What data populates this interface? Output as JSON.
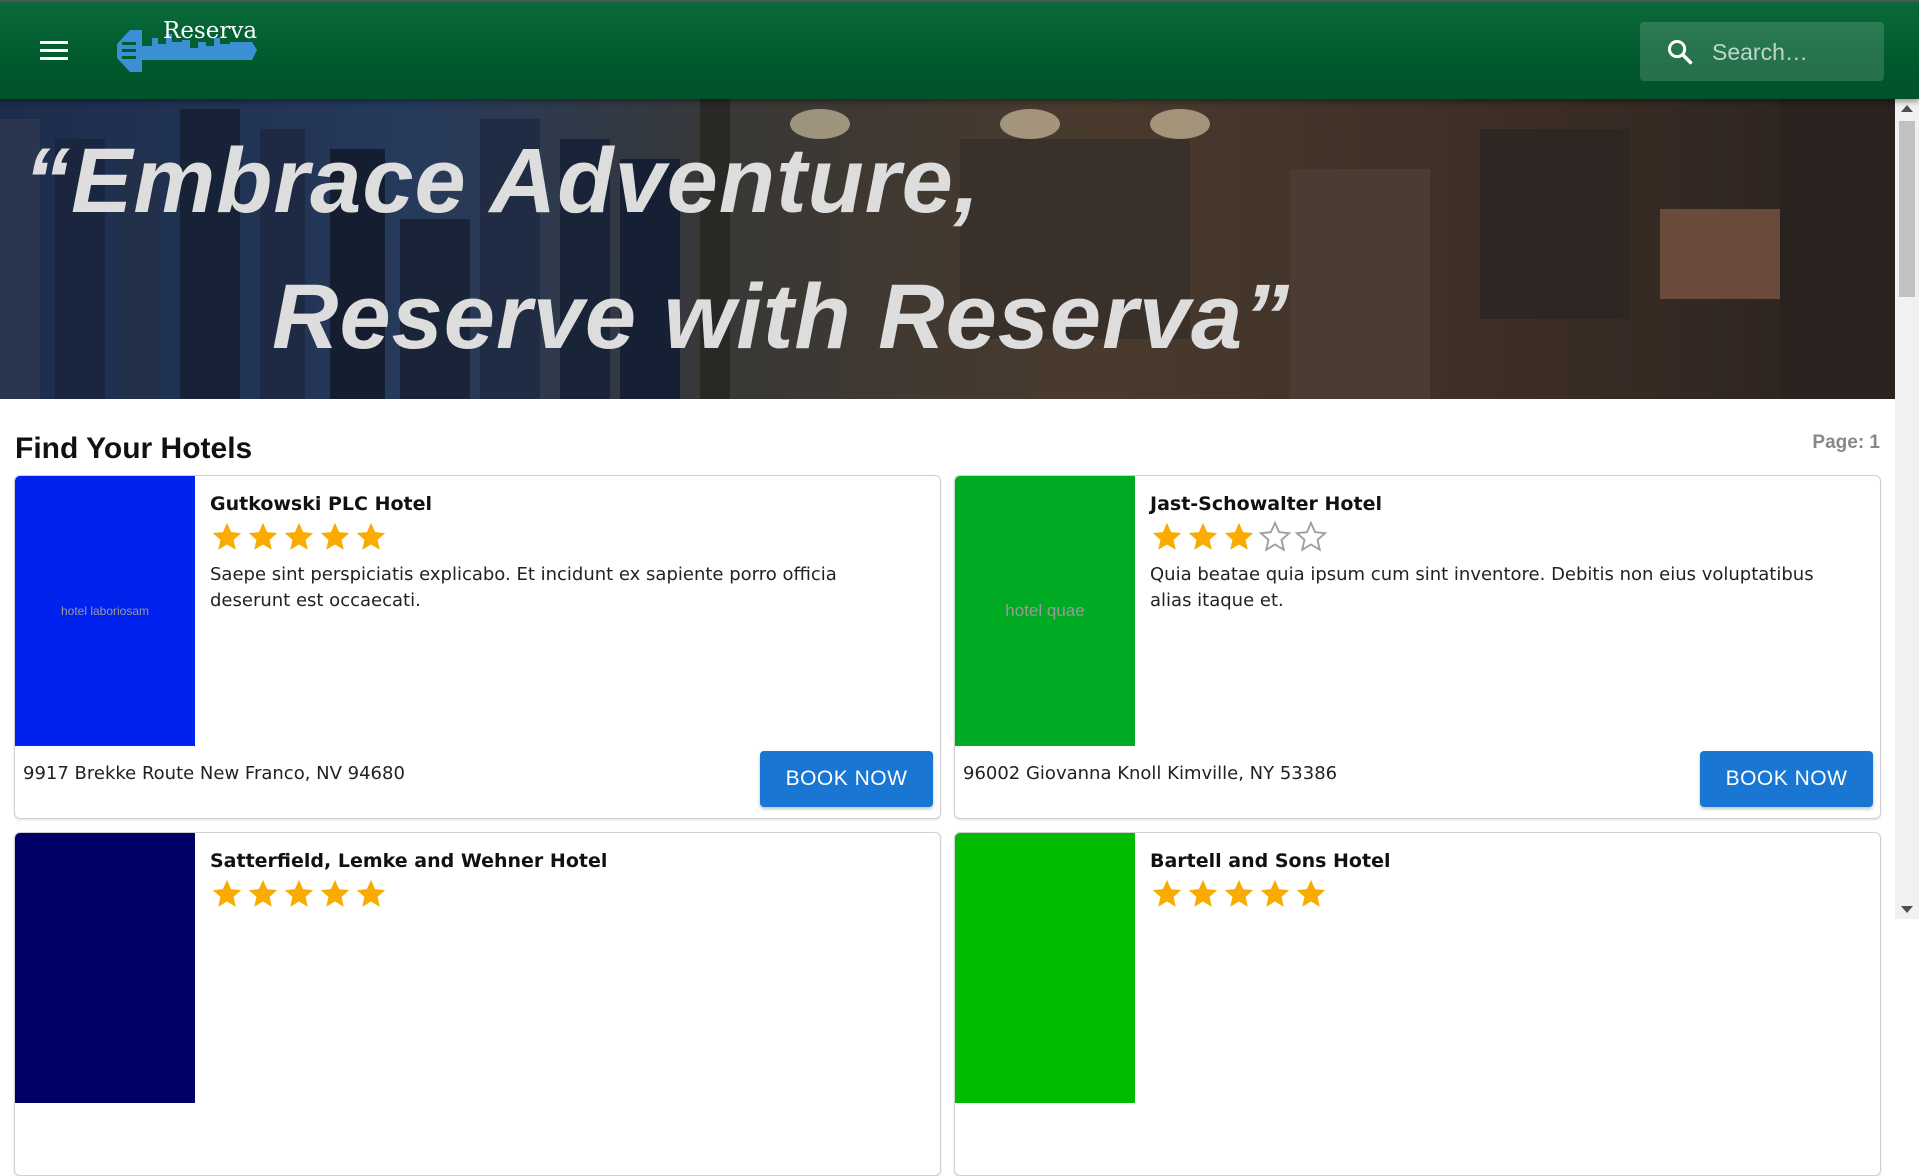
{
  "app": {
    "logo_text": "Reserva"
  },
  "colors": {
    "appbar": "#005a2c",
    "accent": "#1976d2",
    "star": "#f9ab00"
  },
  "icons": {
    "menu": "menu-icon",
    "search": "search-icon",
    "logo": "key-city-logo-icon"
  },
  "search": {
    "placeholder": "Search…"
  },
  "hero": {
    "line1": "“Embrace Adventure,",
    "line2": "Reserve with Reserva”"
  },
  "main": {
    "title": "Find Your Hotels",
    "page_label": "Page: 1"
  },
  "hotels": [
    {
      "name": "Gutkowski PLC Hotel",
      "rating": 5,
      "image_text": "hotel laboriosam",
      "image_color": "#0022ee",
      "description": "Saepe sint perspiciatis explicabo. Et incidunt ex sapiente porro officia deserunt est occaecati.",
      "address": "9917 Brekke Route New Franco, NV 94680",
      "book_label": "BOOK NOW"
    },
    {
      "name": "Jast-Schowalter Hotel",
      "rating": 3,
      "image_text": "hotel quae",
      "image_color": "#00aa22",
      "description": "Quia beatae quia ipsum cum sint inventore. Debitis non eius voluptatibus alias itaque et.",
      "address": "96002 Giovanna Knoll Kimville, NY 53386",
      "book_label": "BOOK NOW"
    },
    {
      "name": "Satterfield, Lemke and Wehner Hotel",
      "rating": 5,
      "image_text": "",
      "image_color": "#000066",
      "description": "",
      "address": "",
      "book_label": ""
    },
    {
      "name": "Bartell and Sons Hotel",
      "rating": 5,
      "image_text": "",
      "image_color": "#00bb00",
      "description": "",
      "address": "",
      "book_label": ""
    }
  ]
}
